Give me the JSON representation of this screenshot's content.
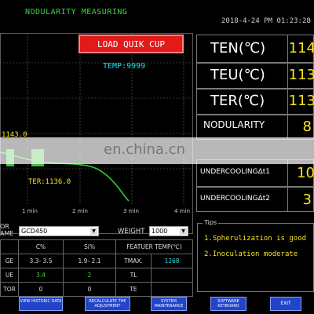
{
  "header": {
    "title": "NODULARITY MEASURING",
    "datetime": "2018-4-24 PM 01:23:28"
  },
  "chart_panel": {
    "load_button": "LOAD QUIK CUP",
    "temp_readout": "TEMP:9999",
    "ann_top": "1143.0",
    "ann_ter": "TER:1136.0",
    "x_ticks": [
      "1 min",
      "2 min",
      "3 min",
      "4 min"
    ],
    "curve_color": "#2ecc2e"
  },
  "readings": {
    "ten": {
      "label": "TEN(℃)",
      "value": "114"
    },
    "teu": {
      "label": "TEU(℃)",
      "value": "113"
    },
    "ter": {
      "label": "TER(℃)",
      "value": "113"
    },
    "nodularity": {
      "label": "NODULARITY",
      "value": "8"
    },
    "uc1": {
      "label": "UNDERCOOLINGΔt1",
      "value": "10"
    },
    "uc2": {
      "label": "UNDERCOOLINGΔt2",
      "value": "3"
    }
  },
  "bottom": {
    "name_label_1": "OR",
    "name_label_2": "AME",
    "grade_value": "GCD450",
    "weight_label": "WEIGHT",
    "weight_value": "1000",
    "table": {
      "headers": [
        "",
        "C%",
        "Si%",
        "FEATUER TEMP(℃)",
        ""
      ],
      "rows": [
        [
          "GE",
          "3.3- 3.5",
          "1.9- 2.1",
          "TMAX.",
          "1268"
        ],
        [
          "UE",
          "3.4",
          "2",
          "TL",
          ""
        ],
        [
          "TOR",
          "0",
          "0",
          "TE",
          ""
        ]
      ]
    },
    "tips": {
      "title": "Tips",
      "items": [
        "1.Spherulization is good",
        "2.Inoculation moderate"
      ]
    },
    "buttons": [
      "VIEW HISTORIC DATA",
      "RECALCULATE THE ADJUSTMENT",
      "SYSTEM MAINTENANCE",
      "SOFTWARE KEYBOARD",
      "EXIT"
    ]
  },
  "watermark": "en.china.cn"
}
